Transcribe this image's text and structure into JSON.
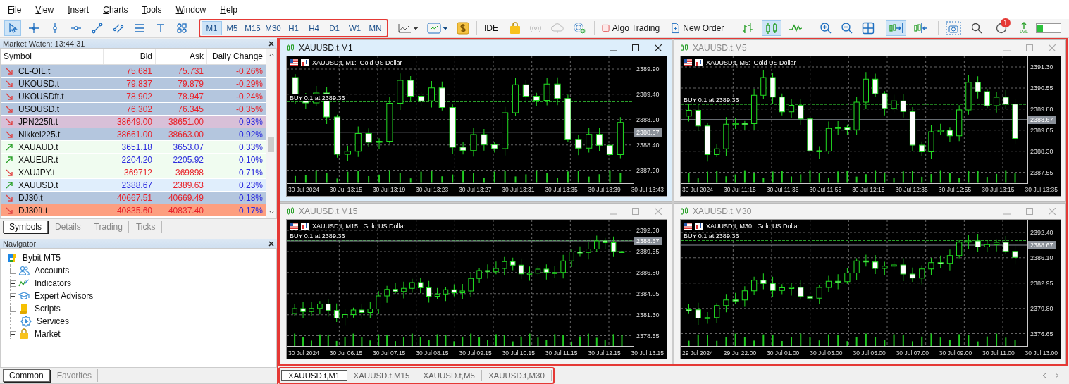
{
  "menu": [
    "File",
    "View",
    "Insert",
    "Charts",
    "Tools",
    "Window",
    "Help"
  ],
  "toolbar": {
    "drawing_tools": [
      {
        "kind": "cursor",
        "selected": true
      },
      {
        "kind": "crosshair",
        "selected": false
      },
      {
        "kind": "vline",
        "selected": false
      },
      {
        "kind": "hline",
        "selected": false
      },
      {
        "kind": "trendline",
        "selected": false
      },
      {
        "kind": "channel",
        "selected": false
      },
      {
        "kind": "fibo",
        "selected": false
      },
      {
        "kind": "text",
        "selected": false
      },
      {
        "kind": "shapes",
        "selected": false
      }
    ],
    "timeframes": [
      {
        "label": "M1",
        "selected": true
      },
      {
        "label": "M5",
        "selected": false
      },
      {
        "label": "M15",
        "selected": false
      },
      {
        "label": "M30",
        "selected": false
      },
      {
        "label": "H1",
        "selected": false
      },
      {
        "label": "H4",
        "selected": false
      },
      {
        "label": "D1",
        "selected": false
      },
      {
        "label": "W1",
        "selected": false
      },
      {
        "label": "MN",
        "selected": false
      }
    ],
    "ide_label": "IDE",
    "algo_trading": "Algo Trading",
    "new_order": "New Order",
    "chart_types": [
      {
        "kind": "bars",
        "selected": false
      },
      {
        "kind": "candles",
        "selected": true
      },
      {
        "kind": "line",
        "selected": false
      }
    ],
    "scroll_tools": [
      {
        "kind": "autoscroll",
        "selected": true
      },
      {
        "kind": "shift",
        "selected": false
      }
    ],
    "notification_count": "1",
    "level_label": "LVL"
  },
  "market_watch": {
    "title": "Market Watch: 13:44:31",
    "columns": [
      "Symbol",
      "Bid",
      "Ask",
      "Daily Change"
    ],
    "rows": [
      {
        "symbol": "CL-OIL.t",
        "bid": "75.681",
        "ask": "75.731",
        "change": "-0.26%",
        "up": false,
        "bid_up": false,
        "ask_up": false,
        "change_up": false,
        "color": "#b4c6de"
      },
      {
        "symbol": "UKOUSD.t",
        "bid": "79.837",
        "ask": "79.879",
        "change": "-0.29%",
        "up": false,
        "bid_up": false,
        "ask_up": false,
        "change_up": false,
        "color": "#b4c6de"
      },
      {
        "symbol": "UKOUSDft.t",
        "bid": "78.902",
        "ask": "78.947",
        "change": "-0.24%",
        "up": false,
        "bid_up": false,
        "ask_up": false,
        "change_up": false,
        "color": "#b4c6de"
      },
      {
        "symbol": "USOUSD.t",
        "bid": "76.302",
        "ask": "76.345",
        "change": "-0.35%",
        "up": false,
        "bid_up": false,
        "ask_up": false,
        "change_up": false,
        "color": "#b4c6de"
      },
      {
        "symbol": "JPN225ft.t",
        "bid": "38649.00",
        "ask": "38651.00",
        "change": "0.93%",
        "up": false,
        "bid_up": false,
        "ask_up": false,
        "change_up": true,
        "color": "#d8c0d8"
      },
      {
        "symbol": "Nikkei225.t",
        "bid": "38661.00",
        "ask": "38663.00",
        "change": "0.92%",
        "up": false,
        "bid_up": false,
        "ask_up": false,
        "change_up": true,
        "color": "#b4c6de"
      },
      {
        "symbol": "XAUAUD.t",
        "bid": "3651.18",
        "ask": "3653.07",
        "change": "0.33%",
        "up": true,
        "bid_up": true,
        "ask_up": true,
        "change_up": true,
        "color": "#f0fcf0"
      },
      {
        "symbol": "XAUEUR.t",
        "bid": "2204.20",
        "ask": "2205.92",
        "change": "0.10%",
        "up": true,
        "bid_up": true,
        "ask_up": true,
        "change_up": true,
        "color": "#f0fcf0"
      },
      {
        "symbol": "XAUJPY.t",
        "bid": "369712",
        "ask": "369898",
        "change": "0.71%",
        "up": false,
        "bid_up": false,
        "ask_up": false,
        "change_up": true,
        "color": "#f0fcf0"
      },
      {
        "symbol": "XAUUSD.t",
        "bid": "2388.67",
        "ask": "2389.63",
        "change": "0.23%",
        "up": true,
        "bid_up": true,
        "ask_up": false,
        "change_up": true,
        "color": "#e0eefc"
      },
      {
        "symbol": "DJ30.t",
        "bid": "40667.51",
        "ask": "40669.49",
        "change": "0.18%",
        "up": false,
        "bid_up": false,
        "ask_up": false,
        "change_up": true,
        "color": "#b4c6de"
      },
      {
        "symbol": "DJ30ft.t",
        "bid": "40835.60",
        "ask": "40837.40",
        "change": "0.17%",
        "up": false,
        "bid_up": false,
        "ask_up": false,
        "change_up": true,
        "color": "#fd9f80"
      }
    ],
    "tabs": [
      {
        "label": "Symbols",
        "selected": true
      },
      {
        "label": "Details",
        "selected": false
      },
      {
        "label": "Trading",
        "selected": false
      },
      {
        "label": "Ticks",
        "selected": false
      }
    ]
  },
  "navigator": {
    "title": "Navigator",
    "root": {
      "label": "Bybit MT5",
      "children": [
        {
          "label": "Accounts",
          "kind": "accounts",
          "expanded": false
        },
        {
          "label": "Indicators",
          "kind": "indicators",
          "expanded": false
        },
        {
          "label": "Expert Advisors",
          "kind": "experts",
          "expanded": false
        },
        {
          "label": "Scripts",
          "kind": "scripts",
          "expanded": false
        },
        {
          "label": "Services",
          "kind": "services"
        },
        {
          "label": "Market",
          "kind": "market",
          "expanded": false
        }
      ]
    },
    "tabs": [
      {
        "label": "Common",
        "selected": true
      },
      {
        "label": "Favorites",
        "selected": false
      }
    ]
  },
  "charts": [
    {
      "title": "XAUUSD.t,M1",
      "active": true,
      "header": "XAUUSD.t, M1:  Gold US Dollar",
      "order_label": "BUY 0.1 at 2389.36",
      "price_tag": "2388.67",
      "y_labels": [
        "2389.90",
        "2389.40",
        "2388.90",
        "2388.40",
        "2387.90"
      ],
      "x_labels": [
        "30 Jul 2024",
        "30 Jul 13:15",
        "30 Jul 13:19",
        "30 Jul 13:23",
        "30 Jul 13:27",
        "30 Jul 13:31",
        "30 Jul 13:35",
        "30 Jul 13:39",
        "30 Jul 13:43"
      ]
    },
    {
      "title": "XAUUSD.t,M5",
      "active": false,
      "header": "XAUUSD.t, M5:  Gold US Dollar",
      "order_label": "BUY 0.1 at 2389.36",
      "price_tag": "2388.67",
      "y_labels": [
        "2391.30",
        "2390.55",
        "2389.80",
        "2389.05",
        "2388.30",
        "2387.55"
      ],
      "x_labels": [
        "30 Jul 2024",
        "30 Jul 11:15",
        "30 Jul 11:35",
        "30 Jul 11:55",
        "30 Jul 12:15",
        "30 Jul 12:35",
        "30 Jul 12:55",
        "30 Jul 13:15",
        "30 Jul 13:35"
      ]
    },
    {
      "title": "XAUUSD.t,M15",
      "active": false,
      "header": "XAUUSD.t, M15:  Gold US Dollar",
      "order_label": "BUY 0.1 at 2389.36",
      "price_tag": "2388.67",
      "y_labels": [
        "2392.30",
        "2389.55",
        "2386.80",
        "2384.05",
        "2381.30",
        "2378.55"
      ],
      "x_labels": [
        "30 Jul 2024",
        "30 Jul 06:15",
        "30 Jul 07:15",
        "30 Jul 08:15",
        "30 Jul 09:15",
        "30 Jul 10:15",
        "30 Jul 11:15",
        "30 Jul 12:15",
        "30 Jul 13:15"
      ]
    },
    {
      "title": "XAUUSD.t,M30",
      "active": false,
      "header": "XAUUSD.t, M30:  Gold US Dollar",
      "order_label": "BUY 0.1 at 2389.36",
      "price_tag": "2388.67",
      "y_labels": [
        "2392.40",
        "2386.10",
        "2382.95",
        "2379.80",
        "2376.65"
      ],
      "x_labels": [
        "29 Jul 2024",
        "29 Jul 22:00",
        "30 Jul 01:00",
        "30 Jul 03:00",
        "30 Jul 05:00",
        "30 Jul 07:00",
        "30 Jul 09:00",
        "30 Jul 11:00",
        "30 Jul 13:00"
      ]
    }
  ],
  "chart_tabs": [
    {
      "label": "XAUUSD.t,M1",
      "selected": true
    },
    {
      "label": "XAUUSD.t,M15",
      "selected": false
    },
    {
      "label": "XAUUSD.t,M5",
      "selected": false
    },
    {
      "label": "XAUUSD.t,M30",
      "selected": false
    }
  ]
}
